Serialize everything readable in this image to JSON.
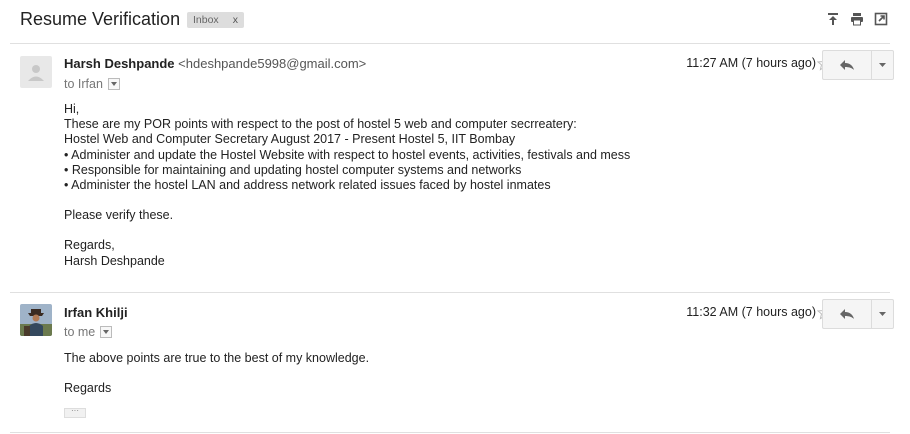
{
  "thread": {
    "subject": "Resume Verification",
    "label": "Inbox",
    "label_remove": "x"
  },
  "messages": [
    {
      "sender_name": "Harsh Deshpande",
      "sender_email": "<hdeshpande5998@gmail.com>",
      "to": "to Irfan",
      "time": "11:27 AM (7 hours ago)",
      "lines": [
        "Hi,",
        "These are my POR points with respect to the post of hostel 5 web and computer secrreatery:",
        "Hostel Web and Computer Secretary August 2017 - Present Hostel 5, IIT Bombay",
        " • Administer and update the Hostel Website with respect to hostel events, activities, festivals and mess",
        " • Responsible for maintaining and updating hostel computer systems and networks",
        " • Administer the hostel LAN and address network related issues faced by hostel inmates",
        "Please verify these.",
        "Regards,",
        "Harsh Deshpande"
      ]
    },
    {
      "sender_name": "Irfan Khilji",
      "to": "to me",
      "time": "11:32 AM (7 hours ago)",
      "lines": [
        "The above points are true to the best of my knowledge.",
        "Regards"
      ],
      "trimmed": "···"
    }
  ]
}
